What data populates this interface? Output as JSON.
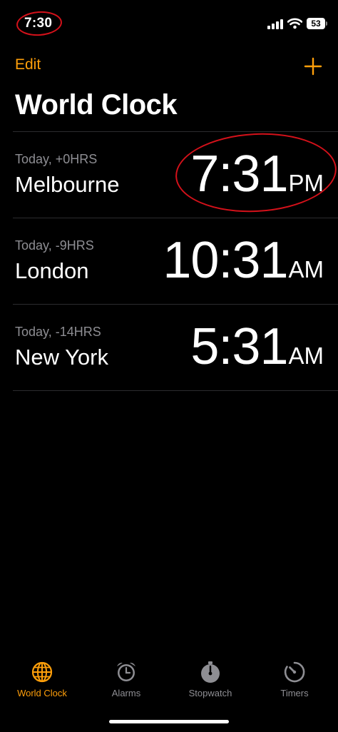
{
  "status_bar": {
    "time": "7:30",
    "battery": "53",
    "signal_icon": "signal-icon",
    "wifi_icon": "wifi-icon"
  },
  "nav": {
    "edit_label": "Edit",
    "add_icon": "plus-icon"
  },
  "title": "World Clock",
  "clocks": [
    {
      "offset": "Today, +0HRS",
      "city": "Melbourne",
      "time": "7:31",
      "ampm": "PM"
    },
    {
      "offset": "Today, -9HRS",
      "city": "London",
      "time": "10:31",
      "ampm": "AM"
    },
    {
      "offset": "Today, -14HRS",
      "city": "New York",
      "time": "5:31",
      "ampm": "AM"
    }
  ],
  "tabs": [
    {
      "label": "World Clock",
      "icon": "globe-icon",
      "active": true
    },
    {
      "label": "Alarms",
      "icon": "alarm-clock-icon",
      "active": false
    },
    {
      "label": "Stopwatch",
      "icon": "stopwatch-icon",
      "active": false
    },
    {
      "label": "Timers",
      "icon": "timer-icon",
      "active": false
    }
  ],
  "colors": {
    "accent": "#ff9f0a",
    "background": "#000000",
    "secondary_text": "#8e8e93",
    "annotation": "#d4111a"
  }
}
